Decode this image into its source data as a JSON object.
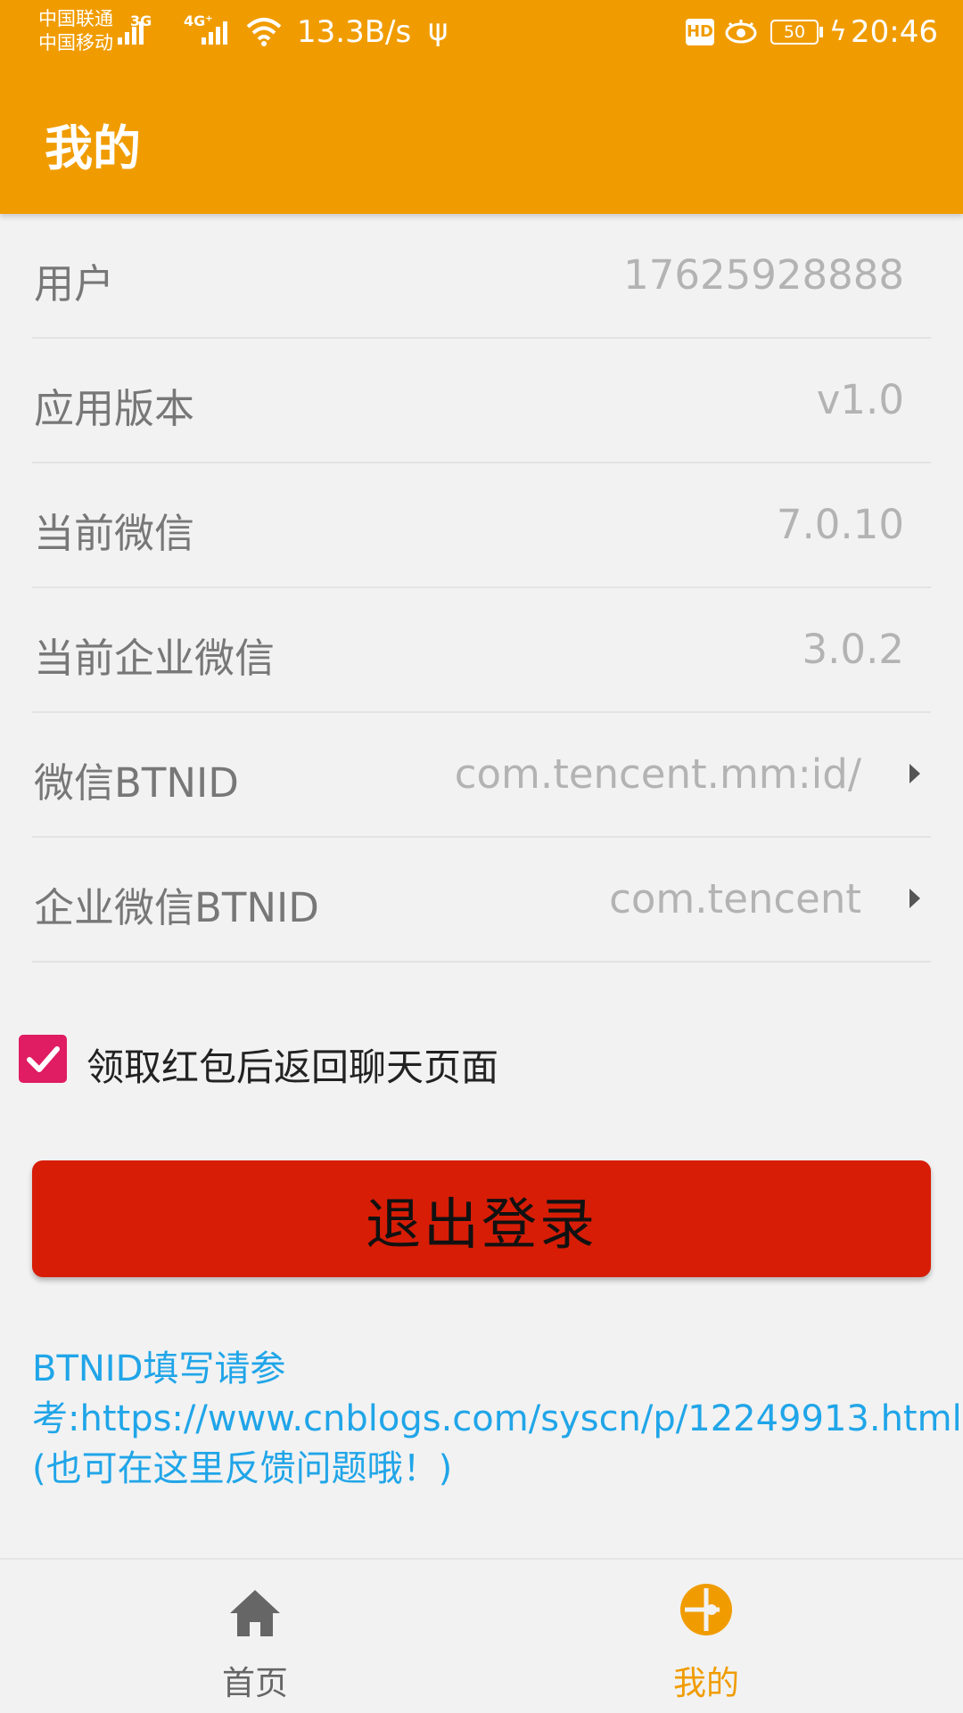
{
  "status_bar": {
    "carrier_1": "中国联通",
    "carrier_2": "中国移动",
    "network_1": "3G",
    "network_2": "4G⁺",
    "speed": "13.3B/s",
    "hd_badge": "HD",
    "battery": "50",
    "time": "20:46"
  },
  "header": {
    "title": "我的"
  },
  "settings": [
    {
      "label": "用户",
      "value": "17625928888"
    },
    {
      "label": "应用版本",
      "value": "v1.0"
    },
    {
      "label": "当前微信",
      "value": "7.0.10"
    },
    {
      "label": "当前企业微信",
      "value": "3.0.2"
    },
    {
      "label": "微信BTNID",
      "value": "com.tencent.mm:id/"
    },
    {
      "label": "企业微信BTNID",
      "value": "com.tencent"
    }
  ],
  "return_option": {
    "label": "领取红包后返回聊天页面",
    "checked": true
  },
  "logout_label": "退出登录",
  "help_text": "BTNID填写请参考:https://www.cnblogs.com/syscn/p/12249913.html (也可在这里反馈问题哦！)",
  "bottom_nav": {
    "tabs": [
      {
        "label": "首页",
        "icon": "home-icon",
        "active": false
      },
      {
        "label": "我的",
        "icon": "profile-pie-icon",
        "active": true
      }
    ],
    "active_color": "#f09c00",
    "inactive_color": "#666666"
  },
  "colors": {
    "accent": "#f09c00",
    "logout": "#d71d06",
    "checkbox": "#e01c62",
    "link": "#20a5e8"
  }
}
